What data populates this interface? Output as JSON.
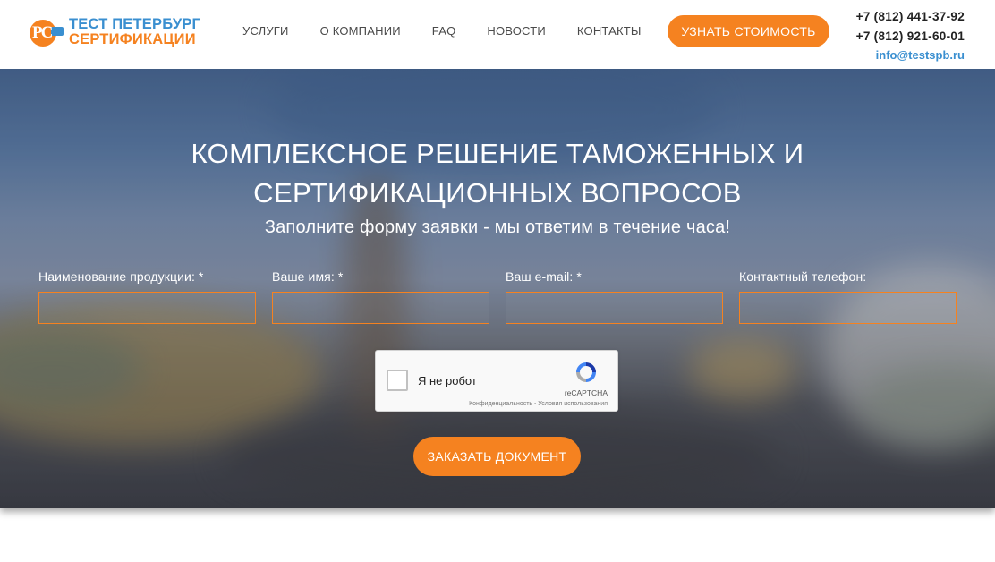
{
  "header": {
    "logo_line1": "ТЕСТ ПЕТЕРБУРГ",
    "logo_line2": "СЕРТИФИКАЦИИ",
    "logo_mark": "PC",
    "nav": [
      {
        "label": "УСЛУГИ"
      },
      {
        "label": "О КОМПАНИИ"
      },
      {
        "label": "FAQ"
      },
      {
        "label": "НОВОСТИ"
      },
      {
        "label": "КОНТАКТЫ"
      }
    ],
    "cta_label": "УЗНАТЬ СТОИМОСТЬ",
    "phone1": "+7 (812) 441-37-92",
    "phone2": "+7 (812) 921-60-01",
    "email": "info@testspb.ru"
  },
  "hero": {
    "title_line1": "КОМПЛЕКСНОЕ РЕШЕНИЕ ТАМОЖЕННЫХ И",
    "title_line2": "СЕРТИФИКАЦИОННЫХ ВОПРОСОВ",
    "subtitle": "Заполните форму заявки - мы ответим в течение часа!",
    "fields": [
      {
        "label": "Наименование продукции: *",
        "value": ""
      },
      {
        "label": "Ваше имя: *",
        "value": ""
      },
      {
        "label": "Ваш e-mail: *",
        "value": ""
      },
      {
        "label": "Контактный телефон:",
        "value": ""
      }
    ],
    "captcha": {
      "label": "Я не робот",
      "brand": "reCAPTCHA",
      "terms": "Конфиденциальность - Условия использования"
    },
    "submit_label": "ЗАКАЗАТЬ ДОКУМЕНТ"
  },
  "colors": {
    "accent": "#f58220",
    "brand_blue": "#3a8fd0"
  }
}
